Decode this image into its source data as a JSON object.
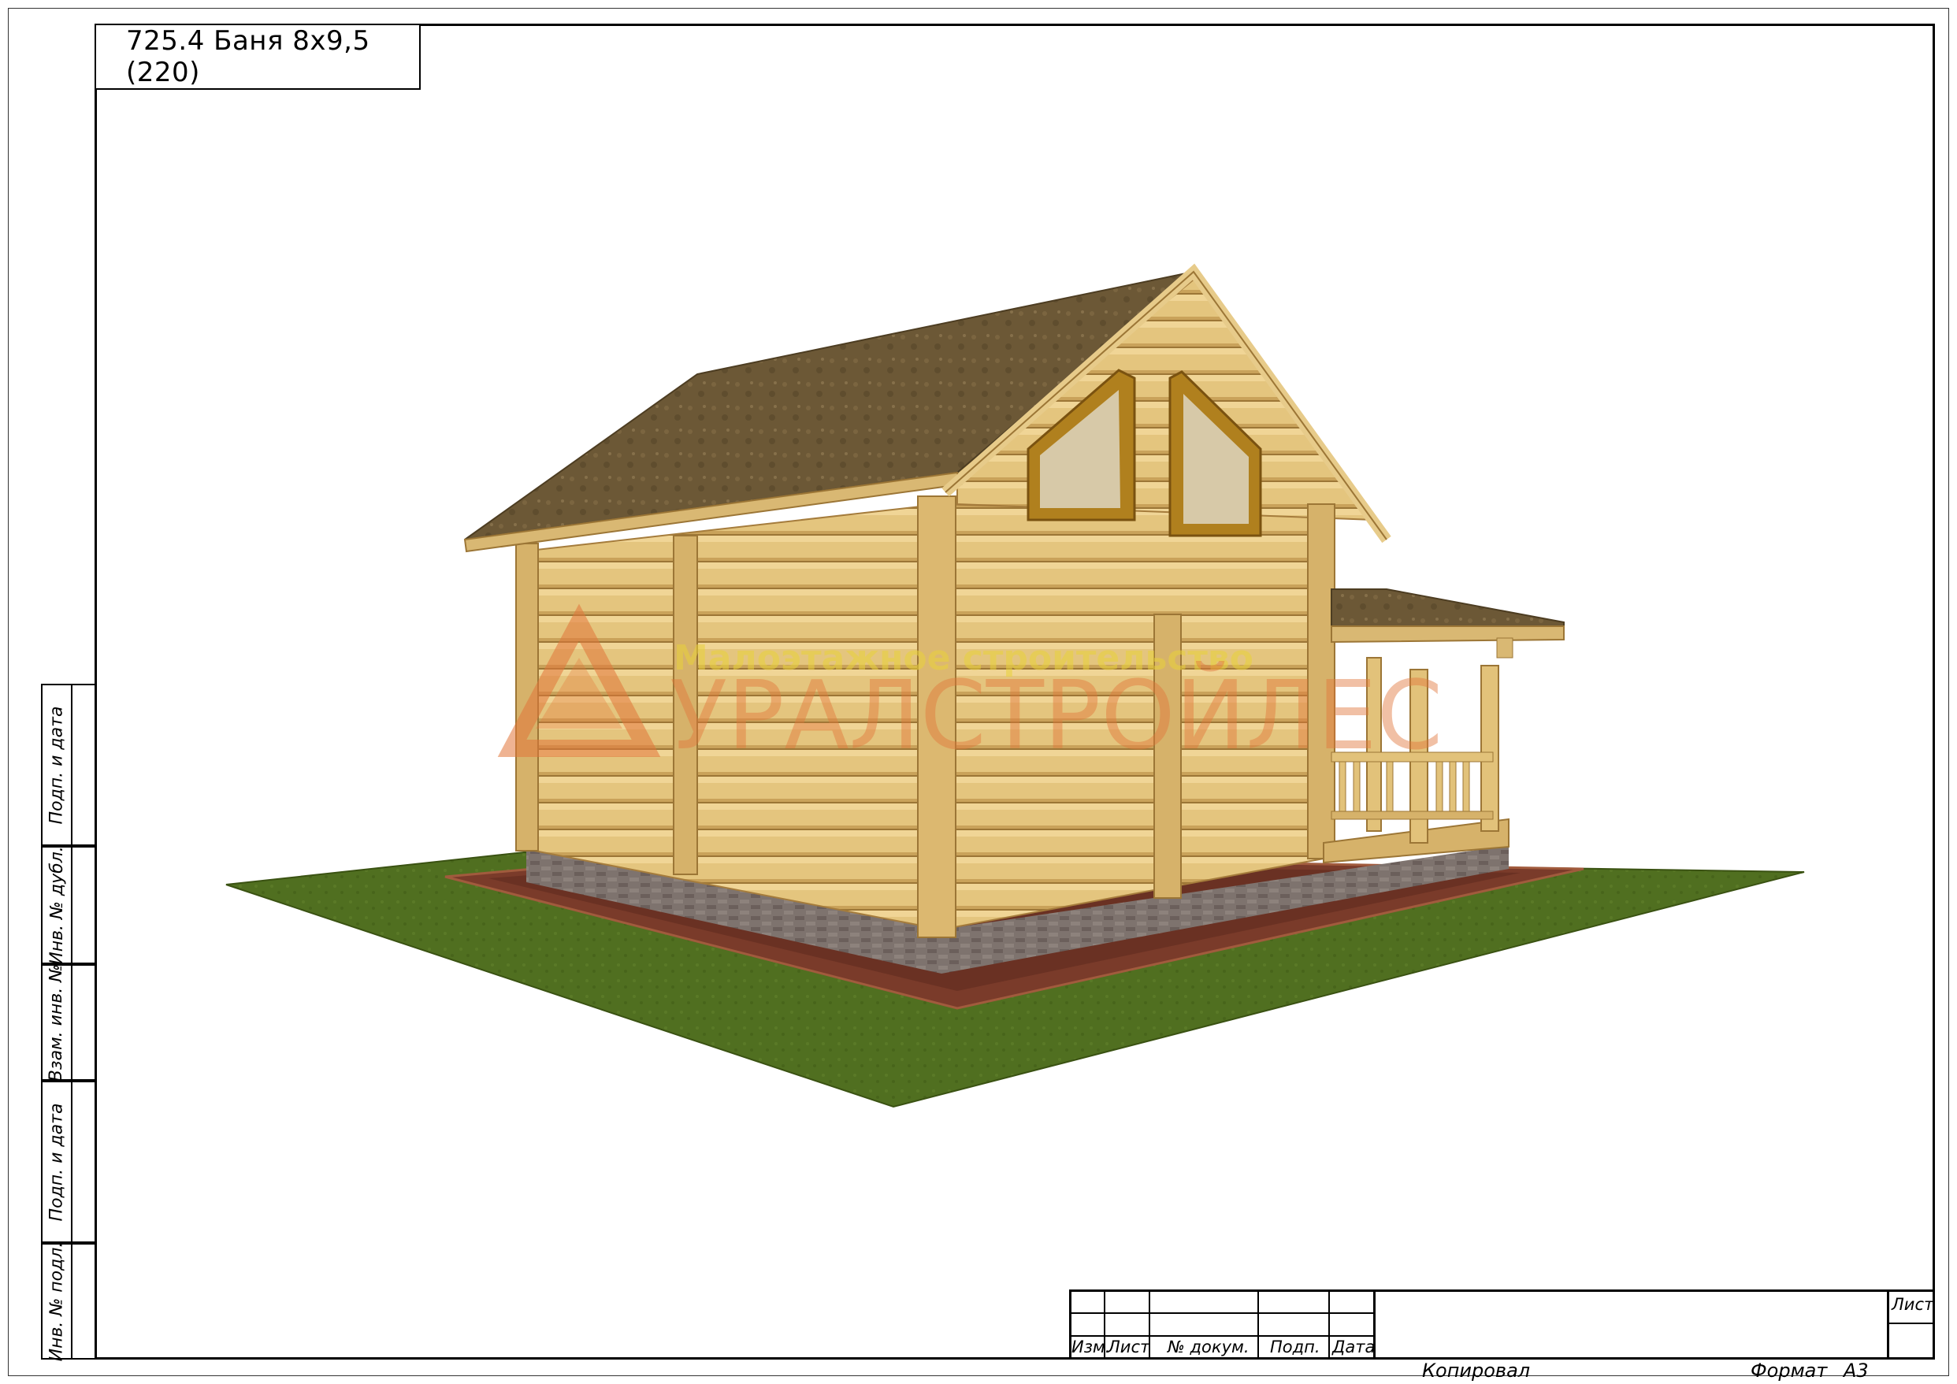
{
  "drawing": {
    "title": "725.4 Баня 8х9,5 (220)",
    "watermark": {
      "tagline": "Малоэтажное строительство",
      "brand": "УРАЛСТРОЙЛЕС"
    }
  },
  "side_stamp": {
    "cells": [
      "Подп. и дата",
      "Инв. № дубл.",
      "Взам. инв. №",
      "Подп. и дата",
      "Инв. № подл."
    ]
  },
  "title_block": {
    "columns": [
      "Изм.",
      "Лист",
      "№ докум.",
      "Подп.",
      "Дата"
    ],
    "sheet_label": "Лист",
    "copied_label": "Копировал",
    "format_label": "Формат",
    "format_value": "А3"
  },
  "colors": {
    "logs": "#e2c27a",
    "log_line": "#b98f45",
    "roof": "#6e5a37",
    "grass": "#4f6e1e",
    "plinth": "#7c6f6a",
    "path": "#7a3b2a",
    "watermark": "#e2763a"
  }
}
